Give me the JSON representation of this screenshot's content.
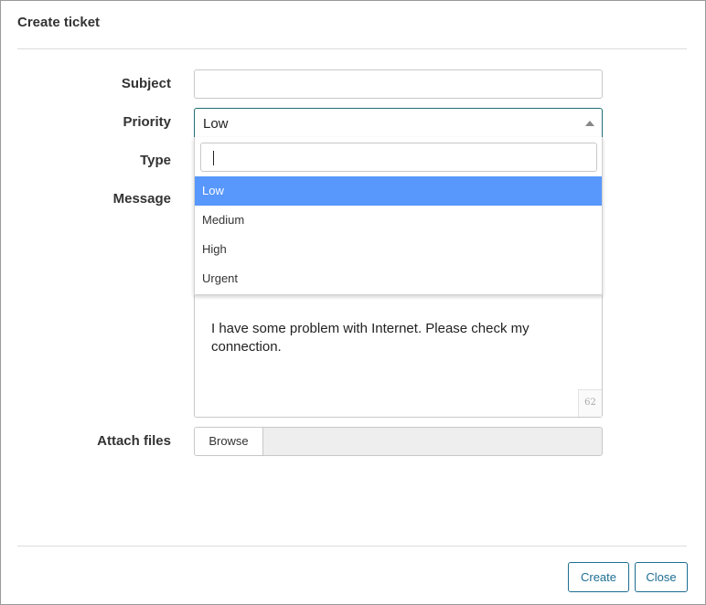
{
  "modal": {
    "title": "Create ticket"
  },
  "form": {
    "subject": {
      "label": "Subject",
      "value": ""
    },
    "priority": {
      "label": "Priority",
      "selected": "Low",
      "search_value": "",
      "options": [
        "Low",
        "Medium",
        "High",
        "Urgent"
      ]
    },
    "type": {
      "label": "Type"
    },
    "message": {
      "label": "Message",
      "value": "I have some problem with Internet. Please check my connection.",
      "char_count": "62"
    },
    "attach": {
      "label": "Attach files",
      "browse_label": "Browse",
      "file_name": ""
    }
  },
  "footer": {
    "create_label": "Create",
    "close_label": "Close"
  },
  "colors": {
    "accent": "#1e6e92",
    "selected_option": "#5897fb"
  }
}
